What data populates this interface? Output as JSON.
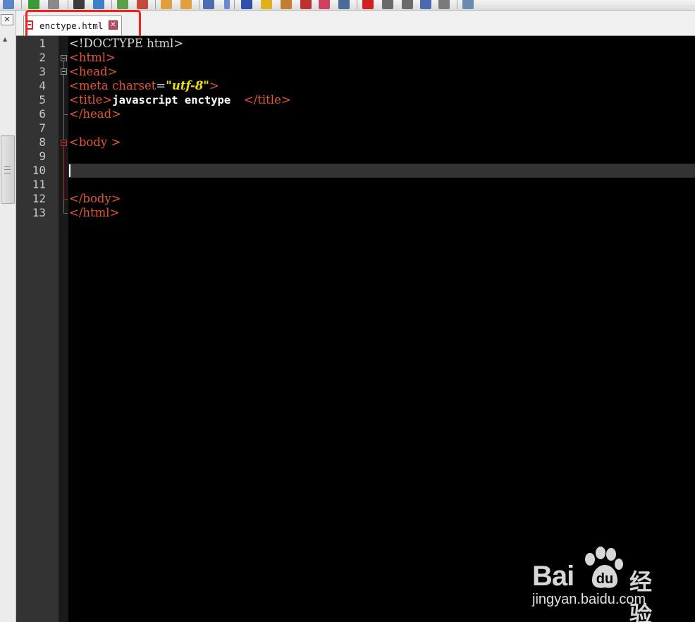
{
  "tab": {
    "filename": "enctype.html",
    "close_glyph": "✕"
  },
  "left_panel": {
    "close_glyph": "✕",
    "scroll_up_glyph": "▲"
  },
  "editor": {
    "line_numbers": [
      "1",
      "2",
      "3",
      "4",
      "5",
      "6",
      "7",
      "8",
      "9",
      "10",
      "11",
      "12",
      "13"
    ],
    "current_line": 10,
    "lines": {
      "l1": "<!DOCTYPE html>",
      "l2_tag": "<html>",
      "l3_tag": "<head>",
      "l4_open": "<meta ",
      "l4_attr": "charset",
      "l4_eq": "=",
      "l4_str": "\"utf-8\"",
      "l4_close": ">",
      "l5_open": "<title>",
      "l5_text": "javascript enctype  ",
      "l5_close": "</title>",
      "l6_tag": "</head>",
      "l8_tag": "<body >",
      "l12_tag": "</body>",
      "l13_tag": "</html>"
    }
  },
  "watermark": {
    "brand_latin": "Bai",
    "brand_cn": "经验",
    "url": "jingyan.baidu.com"
  },
  "colors": {
    "tag": "#e4582f",
    "string": "#f0e000",
    "text": "#ffffff",
    "gutter": "#333333",
    "background": "#000000",
    "highlight": "#f3201b"
  }
}
